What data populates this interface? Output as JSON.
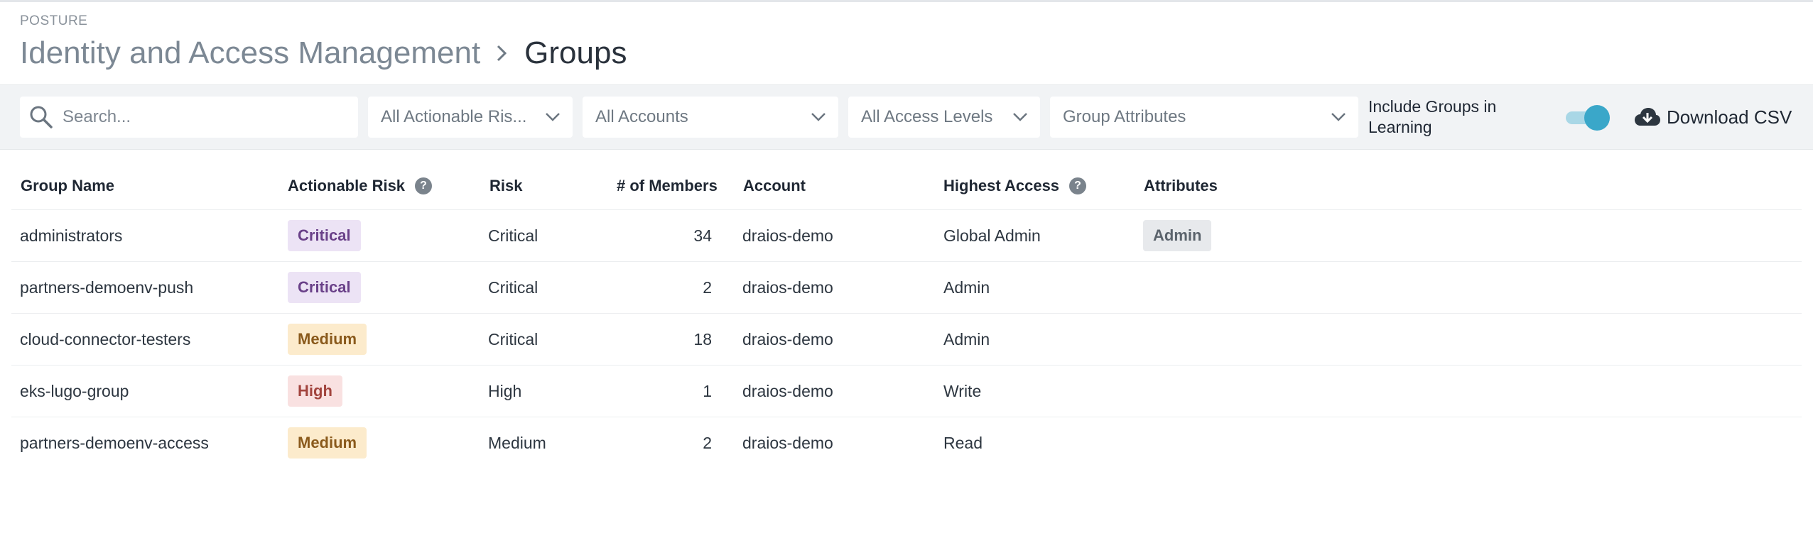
{
  "header": {
    "eyebrow": "POSTURE",
    "parent": "Identity and Access Management",
    "current": "Groups"
  },
  "filters": {
    "search_placeholder": "Search...",
    "actionable_risk": "All Actionable Ris...",
    "accounts": "All Accounts",
    "access_levels": "All Access Levels",
    "group_attributes": "Group Attributes",
    "include_learning_label": "Include Groups in Learning",
    "include_learning_on": true,
    "download_label": "Download CSV"
  },
  "table": {
    "columns": {
      "name": "Group Name",
      "actionable_risk": "Actionable Risk",
      "risk": "Risk",
      "members": "# of Members",
      "account": "Account",
      "highest_access": "Highest Access",
      "attributes": "Attributes"
    },
    "rows": [
      {
        "name": "administrators",
        "actionable_risk": "Critical",
        "risk": "Critical",
        "members": "34",
        "account": "draios-demo",
        "highest_access": "Global Admin",
        "attributes": "Admin"
      },
      {
        "name": "partners-demoenv-push",
        "actionable_risk": "Critical",
        "risk": "Critical",
        "members": "2",
        "account": "draios-demo",
        "highest_access": "Admin",
        "attributes": ""
      },
      {
        "name": "cloud-connector-testers",
        "actionable_risk": "Medium",
        "risk": "Critical",
        "members": "18",
        "account": "draios-demo",
        "highest_access": "Admin",
        "attributes": ""
      },
      {
        "name": "eks-lugo-group",
        "actionable_risk": "High",
        "risk": "High",
        "members": "1",
        "account": "draios-demo",
        "highest_access": "Write",
        "attributes": ""
      },
      {
        "name": "partners-demoenv-access",
        "actionable_risk": "Medium",
        "risk": "Medium",
        "members": "2",
        "account": "draios-demo",
        "highest_access": "Read",
        "attributes": ""
      }
    ]
  },
  "colors": {
    "critical_bg": "#ece3f5",
    "medium_bg": "#fcebcc",
    "high_bg": "#f9e1e1",
    "toggle_accent": "#3aa7c9"
  },
  "icons": {
    "search": "search-icon",
    "chevron": "chevron-down-icon",
    "download": "cloud-download-icon",
    "help": "help-icon",
    "breadcrumb_separator": "chevron-right-icon"
  }
}
